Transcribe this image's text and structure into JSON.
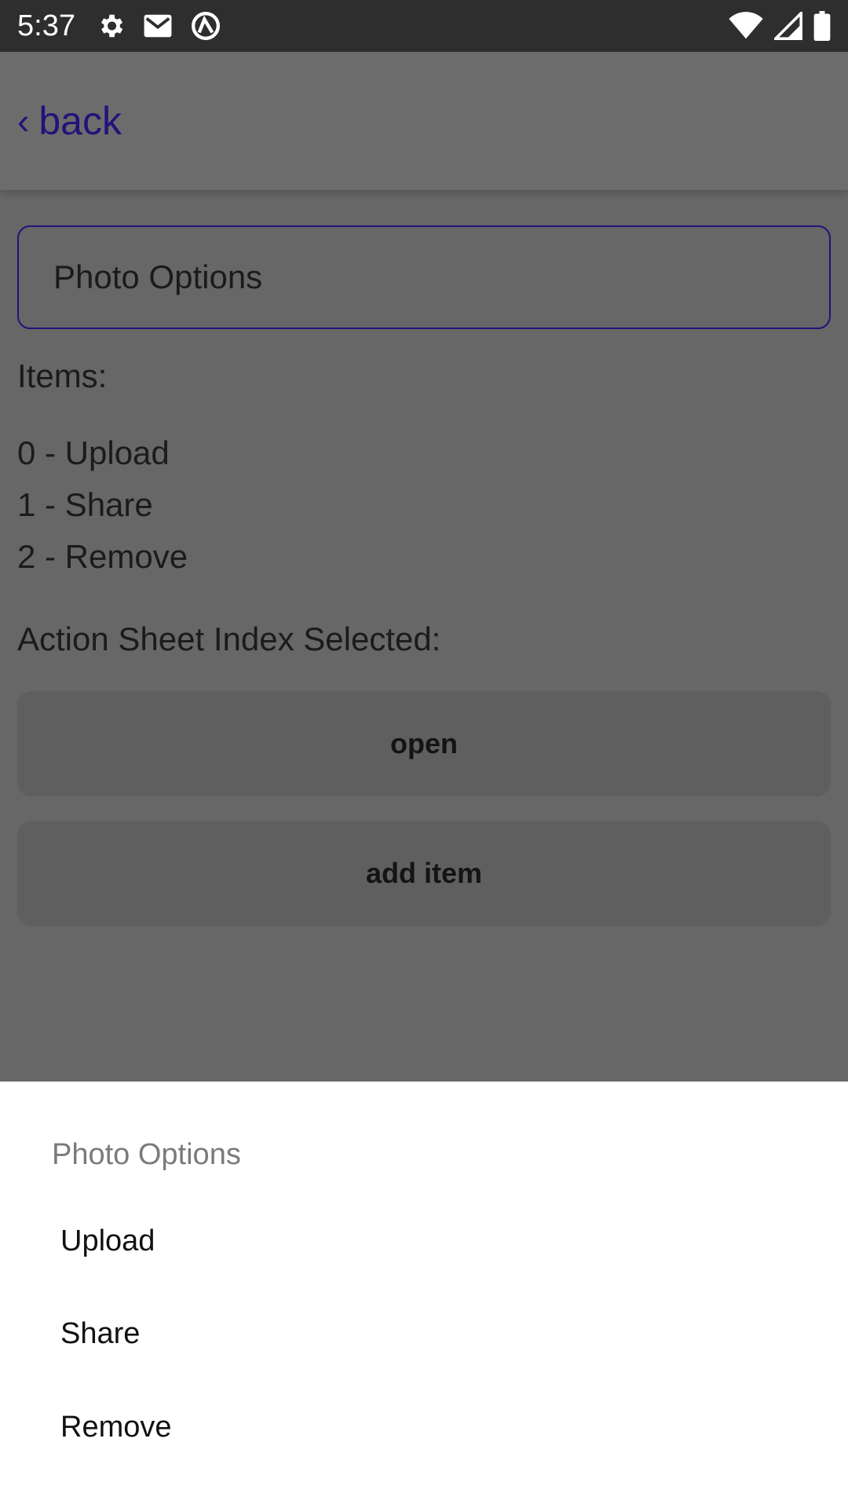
{
  "status_bar": {
    "time": "5:37",
    "left_icons": [
      "settings-icon",
      "gmail-icon",
      "vpn-icon"
    ],
    "right_icons": [
      "wifi-icon",
      "signal-icon",
      "battery-icon"
    ]
  },
  "header": {
    "back_label": "back",
    "back_chevron": "‹",
    "accent_color": "#23127a"
  },
  "content": {
    "title_input_value": "Photo Options",
    "items_label": "Items:",
    "items": [
      "0 - Upload",
      "1 - Share",
      "2 - Remove"
    ],
    "index_label": "Action Sheet Index Selected:",
    "open_button": "open",
    "add_item_button": "add item"
  },
  "action_sheet": {
    "title": "Photo Options",
    "options": [
      "Upload",
      "Share",
      "Remove"
    ]
  }
}
